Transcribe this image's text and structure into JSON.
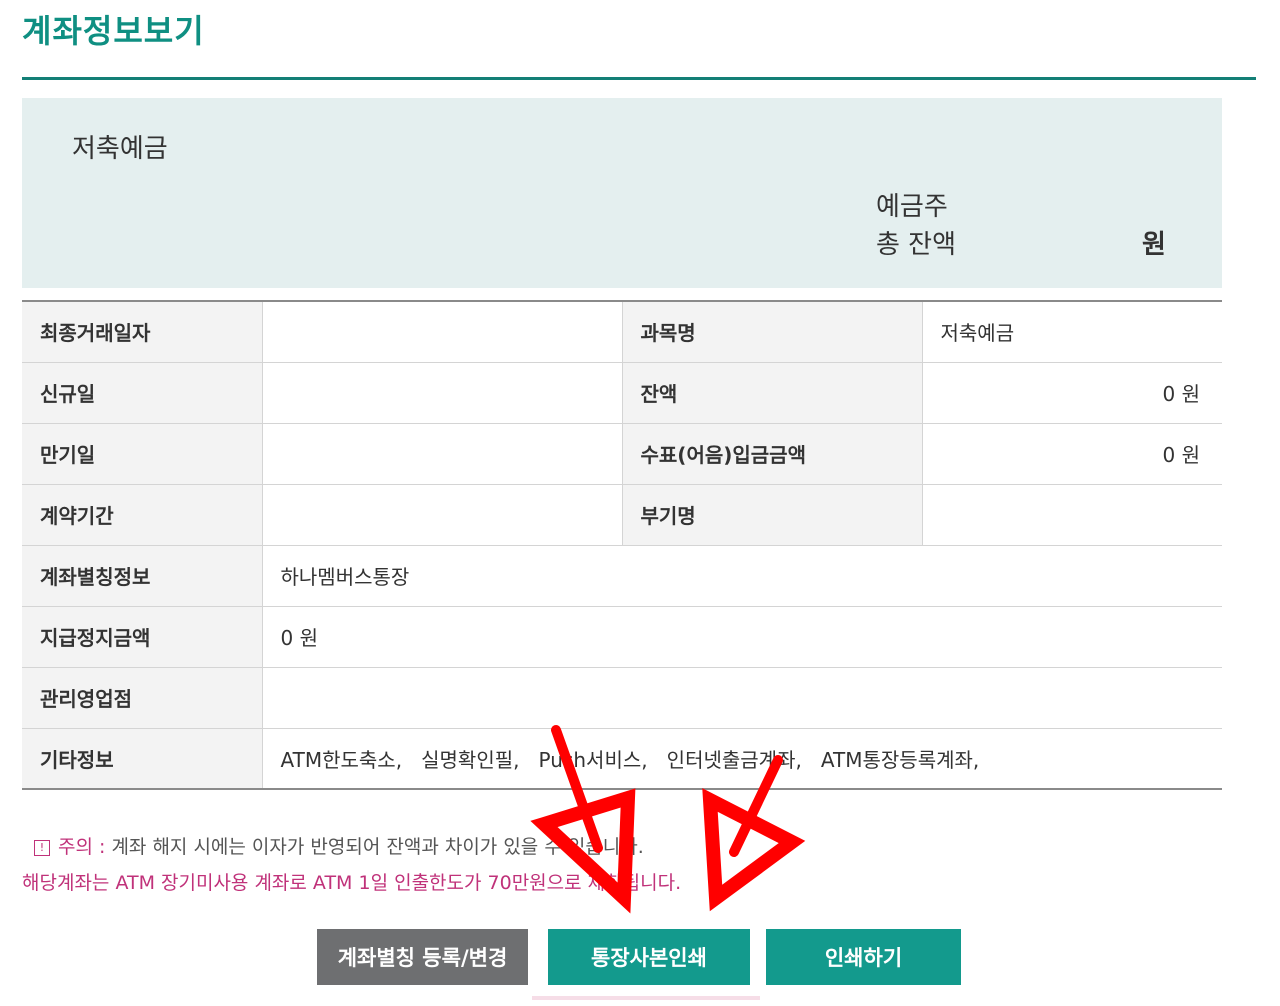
{
  "page": {
    "title": "계좌정보보기"
  },
  "summary": {
    "product_name": "저축예금",
    "holder_label": "예금주",
    "total_balance_label": "총 잔액",
    "total_balance_unit": "원"
  },
  "table": {
    "rows": [
      {
        "label": "최종거래일자",
        "value": "",
        "label2": "과목명",
        "value2": "저축예금"
      },
      {
        "label": "신규일",
        "value": "",
        "label2": "잔액",
        "value2": "0 원"
      },
      {
        "label": "만기일",
        "value": "",
        "label2": "수표(어음)입금금액",
        "value2": "0 원"
      },
      {
        "label": "계약기간",
        "value": "",
        "label2": "부기명",
        "value2": ""
      },
      {
        "label": "계좌별칭정보",
        "value": "하나멤버스통장"
      },
      {
        "label": "지급정지금액",
        "value": "0 원"
      },
      {
        "label": "관리영업점",
        "value": ""
      },
      {
        "label": "기타정보",
        "value": "ATM한도축소,   실명확인필,   Push서비스,   인터넷출금계좌,   ATM통장등록계좌,"
      }
    ]
  },
  "notice": {
    "icon": "!",
    "label": "주의 :",
    "text1": "계좌 해지 시에는 이자가 반영되어 잔액과 차이가 있을 수 있습니다.",
    "text2": "해당계좌는 ATM 장기미사용 계좌로 ATM 1일 인출한도가 70만원으로 제한됩니다."
  },
  "buttons": {
    "alias": "계좌별칭 등록/변경",
    "passbook_print": "통장사본인쇄",
    "print": "인쇄하기"
  },
  "colors": {
    "brand_teal": "#139a8d",
    "alert_pink": "#c0327a",
    "arrow_red": "#ff0000"
  }
}
